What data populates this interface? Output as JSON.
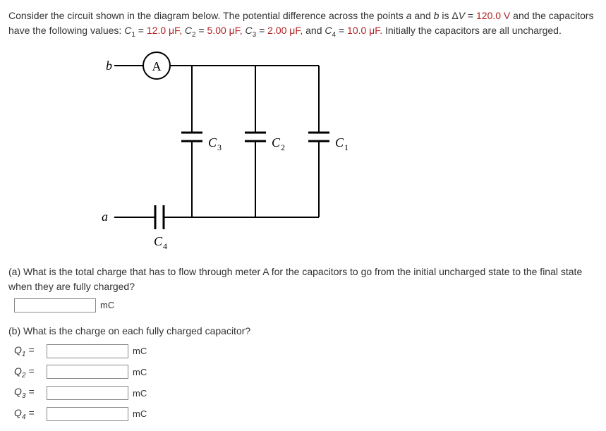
{
  "problem": {
    "intro_1": "Consider the circuit shown in the diagram below. The potential difference across the points ",
    "a": "a",
    "and": " and ",
    "b": "b",
    "is": " is  Δ",
    "V": "V",
    "eq1": " = ",
    "val_v": "120.0 V",
    "intro_2": "  and the capacitors have the following values: ",
    "c1": "C",
    "c1eq": " = ",
    "val_c1": "12.0 μF,",
    "sp1": "   ",
    "c2": "C",
    "c2eq": " = ",
    "val_c2": "5.00 μF,",
    "sp2": "   ",
    "c3": "C",
    "c3eq": " = ",
    "val_c3": "2.00 μF,",
    "sp3": "  and  ",
    "c4": "C",
    "c4eq": " = ",
    "val_c4": "10.0 μF.",
    "intro_3": "  Initially the capacitors are all uncharged."
  },
  "diagram": {
    "b": "b",
    "a": "a",
    "A": "A",
    "C1": "C",
    "C2": "C",
    "C3": "C",
    "C4": "C"
  },
  "part_a": {
    "label": "(a) What is the total charge that has to flow through meter A for the capacitors to go from the initial uncharged state to the final state when they are fully charged?",
    "unit": "mC"
  },
  "part_b": {
    "label": "(b) What is the charge on each fully charged capacitor?",
    "q1": "Q",
    "q2": "Q",
    "q3": "Q",
    "q4": "Q",
    "eq": " = ",
    "unit": "mC"
  }
}
